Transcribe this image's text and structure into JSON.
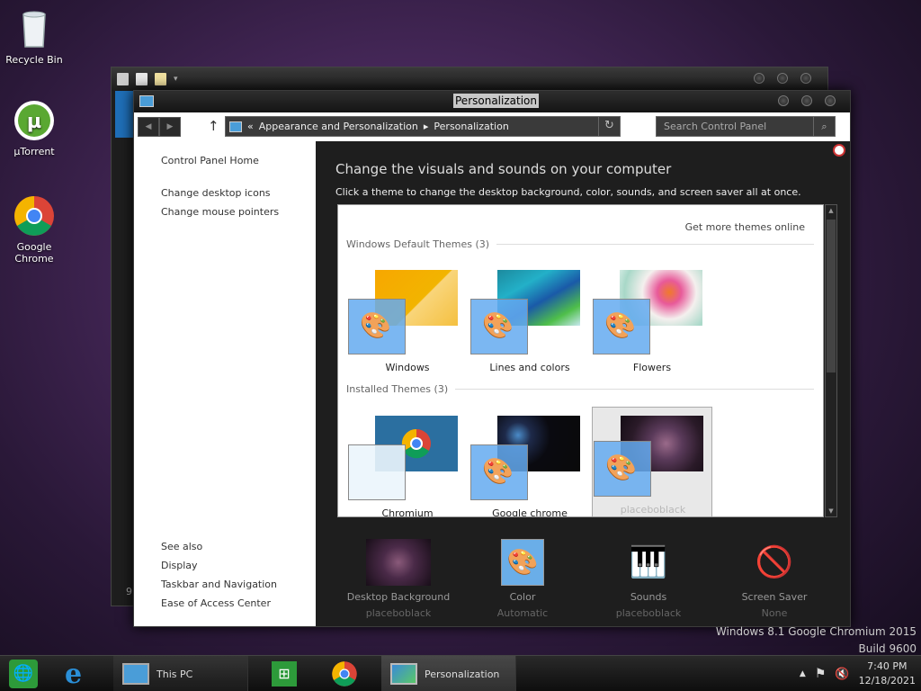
{
  "desktop": {
    "icons": [
      {
        "label": "Recycle Bin"
      },
      {
        "label": "µTorrent"
      },
      {
        "label": "Google Chrome"
      }
    ],
    "watermark_line1": "Windows 8.1 Google Chromium 2015",
    "watermark_line2": "Build 9600"
  },
  "bg_window": {
    "stray_char": "9"
  },
  "window": {
    "title": "Personalization",
    "address": {
      "separator": "«",
      "crumb1": "Appearance and Personalization",
      "arrow": "▸",
      "crumb2": "Personalization"
    },
    "search_placeholder": "Search Control Panel"
  },
  "sidebar": {
    "home": "Control Panel Home",
    "links": [
      "Change desktop icons",
      "Change mouse pointers"
    ],
    "see_also": "See also",
    "see_also_links": [
      "Display",
      "Taskbar and Navigation",
      "Ease of Access Center"
    ]
  },
  "main": {
    "heading": "Change the visuals and sounds on your computer",
    "subheading": "Click a theme to change the desktop background, color, sounds, and screen saver all at once.",
    "get_more": "Get more themes online",
    "default_group": "Windows Default Themes (3)",
    "installed_group": "Installed Themes (3)",
    "default_themes": [
      {
        "name": "Windows"
      },
      {
        "name": "Lines and colors"
      },
      {
        "name": "Flowers"
      }
    ],
    "installed_themes": [
      {
        "name": "Chromium"
      },
      {
        "name": "Google chrome"
      },
      {
        "name": "placeboblack"
      }
    ]
  },
  "bottom": [
    {
      "label": "Desktop Background",
      "value": "placeboblack"
    },
    {
      "label": "Color",
      "value": "Automatic"
    },
    {
      "label": "Sounds",
      "value": "placeboblack"
    },
    {
      "label": "Screen Saver",
      "value": "None"
    }
  ],
  "taskbar": {
    "this_pc": "This PC",
    "personalization": "Personalization",
    "time": "7:40 PM",
    "date": "12/18/2021"
  }
}
